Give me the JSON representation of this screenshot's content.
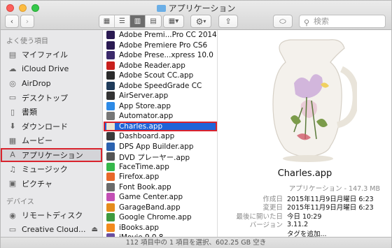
{
  "window": {
    "title": "アプリケーション"
  },
  "toolbar": {
    "back": "‹",
    "forward": "›",
    "search_placeholder": "検索"
  },
  "sidebar": {
    "favorites_header": "よく使う項目",
    "devices_header": "デバイス",
    "favorites": [
      {
        "label": "マイファイル",
        "icon": "all-files-icon",
        "glyph": "▤"
      },
      {
        "label": "iCloud Drive",
        "icon": "cloud-icon",
        "glyph": "☁"
      },
      {
        "label": "AirDrop",
        "icon": "airdrop-icon",
        "glyph": "◎"
      },
      {
        "label": "デスクトップ",
        "icon": "desktop-icon",
        "glyph": "▭"
      },
      {
        "label": "書類",
        "icon": "document-icon",
        "glyph": "▯"
      },
      {
        "label": "ダウンロード",
        "icon": "download-icon",
        "glyph": "⬇"
      },
      {
        "label": "ムービー",
        "icon": "movie-icon",
        "glyph": "▦"
      },
      {
        "label": "アプリケーション",
        "icon": "applications-icon",
        "glyph": "A"
      },
      {
        "label": "ミュージック",
        "icon": "music-icon",
        "glyph": "♫"
      },
      {
        "label": "ピクチャ",
        "icon": "pictures-icon",
        "glyph": "▣"
      }
    ],
    "devices": [
      {
        "label": "リモートディスク",
        "icon": "remote-disc-icon",
        "glyph": "◉"
      },
      {
        "label": "Creative Cloud...",
        "icon": "drive-icon",
        "glyph": "▭",
        "eject": "⏏"
      }
    ]
  },
  "files": [
    {
      "name": "Adobe Premi...Pro CC 2014",
      "color": "#2a1a52"
    },
    {
      "name": "Adobe Premiere Pro CS6",
      "color": "#2a1a52"
    },
    {
      "name": "Adobe Prese...xpress 10.0",
      "color": "#3b2a6b"
    },
    {
      "name": "Adobe Reader.app",
      "color": "#c8201d"
    },
    {
      "name": "Adobe Scout CC.app",
      "color": "#2b2b2b"
    },
    {
      "name": "Adobe SpeedGrade CC",
      "color": "#1f3b5a"
    },
    {
      "name": "AirServer.app",
      "color": "#333333"
    },
    {
      "name": "App Store.app",
      "color": "#2d8ae6"
    },
    {
      "name": "Automator.app",
      "color": "#777777"
    },
    {
      "name": "Charles.app",
      "color": "#e9e3d2",
      "selected": true
    },
    {
      "name": "Dashboard.app",
      "color": "#3a3a3a"
    },
    {
      "name": "DPS App Builder.app",
      "color": "#2a62b0"
    },
    {
      "name": "DVD プレーヤー.app",
      "color": "#555555"
    },
    {
      "name": "FaceTime.app",
      "color": "#35b84b"
    },
    {
      "name": "Firefox.app",
      "color": "#e8682a"
    },
    {
      "name": "Font Book.app",
      "color": "#6b6b6b"
    },
    {
      "name": "Game Center.app",
      "color": "#c34fb5"
    },
    {
      "name": "GarageBand.app",
      "color": "#e58c1c"
    },
    {
      "name": "Google Chrome.app",
      "color": "#3f9a3f"
    },
    {
      "name": "iBooks.app",
      "color": "#f28a1d"
    },
    {
      "name": "iMovie 9.0.8",
      "color": "#6a4fa0"
    }
  ],
  "preview": {
    "app_name": "Charles.app",
    "kind": "アプリケーション - 147.3 MB",
    "info": [
      {
        "key": "作成日",
        "value": "2015年11月9日月曜日 6:23"
      },
      {
        "key": "変更日",
        "value": "2015年11月9日月曜日 6:23"
      },
      {
        "key": "最後に開いた日",
        "value": "今日 10:29"
      },
      {
        "key": "バージョン",
        "value": "3.11.2"
      }
    ],
    "add_tags": "タグを追加..."
  },
  "status": {
    "text": "112 項目中の 1 項目を選択、602.25 GB 空き"
  }
}
